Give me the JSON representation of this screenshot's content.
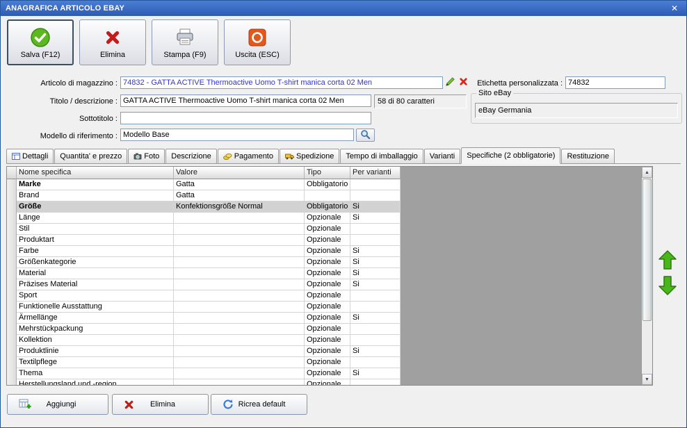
{
  "window": {
    "title": "ANAGRAFICA ARTICOLO EBAY",
    "close_glyph": "✕"
  },
  "toolbar": {
    "save": "Salva (F12)",
    "delete": "Elimina",
    "print": "Stampa (F9)",
    "exit": "Uscita (ESC)"
  },
  "form": {
    "articolo_label": "Articolo di magazzino :",
    "articolo_value": "74832 - GATTA ACTIVE Thermoactive Uomo T-shirt manica corta 02 Men",
    "etichetta_label": "Etichetta personalizzata :",
    "etichetta_value": "74832",
    "titolo_label": "Titolo / descrizione :",
    "titolo_value": "GATTA ACTIVE Thermoactive Uomo T-shirt manica corta 02 Men",
    "caratteri_info": "58 di 80 caratteri",
    "sito_group_label": "Sito eBay",
    "sito_value": "eBay Germania",
    "sottotitolo_label": "Sottotitolo :",
    "sottotitolo_value": "",
    "modello_label": "Modello di riferimento :",
    "modello_value": "Modello Base"
  },
  "tabs": [
    {
      "label": "Dettagli",
      "icon": "details-icon",
      "active": false
    },
    {
      "label": "Quantita' e prezzo",
      "icon": "",
      "active": false
    },
    {
      "label": "Foto",
      "icon": "camera-icon",
      "active": false
    },
    {
      "label": "Descrizione",
      "icon": "",
      "active": false
    },
    {
      "label": "Pagamento",
      "icon": "money-icon",
      "active": false
    },
    {
      "label": "Spedizione",
      "icon": "shipping-icon",
      "active": false
    },
    {
      "label": "Tempo di imballaggio",
      "icon": "",
      "active": false
    },
    {
      "label": "Varianti",
      "icon": "",
      "active": false
    },
    {
      "label": "Specifiche (2 obbligatorie)",
      "icon": "",
      "active": true
    },
    {
      "label": "Restituzione",
      "icon": "",
      "active": false
    }
  ],
  "grid": {
    "headers": [
      "Nome specifica",
      "Valore",
      "Tipo",
      "Per varianti"
    ],
    "rows": [
      {
        "nome": "Marke",
        "valore": "Gatta",
        "tipo": "Obbligatorio",
        "per_varianti": "",
        "bold": true,
        "selected": false
      },
      {
        "nome": "Brand",
        "valore": "Gatta",
        "tipo": "",
        "per_varianti": "",
        "bold": false,
        "selected": false
      },
      {
        "nome": "Größe",
        "valore": "Konfektionsgröße Normal",
        "tipo": "Obbligatorio",
        "per_varianti": "Si",
        "bold": true,
        "selected": true
      },
      {
        "nome": "Länge",
        "valore": "",
        "tipo": "Opzionale",
        "per_varianti": "Si",
        "bold": false,
        "selected": false
      },
      {
        "nome": "Stil",
        "valore": "",
        "tipo": "Opzionale",
        "per_varianti": "",
        "bold": false,
        "selected": false
      },
      {
        "nome": "Produktart",
        "valore": "",
        "tipo": "Opzionale",
        "per_varianti": "",
        "bold": false,
        "selected": false
      },
      {
        "nome": "Farbe",
        "valore": "",
        "tipo": "Opzionale",
        "per_varianti": "Si",
        "bold": false,
        "selected": false
      },
      {
        "nome": "Größenkategorie",
        "valore": "",
        "tipo": "Opzionale",
        "per_varianti": "Si",
        "bold": false,
        "selected": false
      },
      {
        "nome": "Material",
        "valore": "",
        "tipo": "Opzionale",
        "per_varianti": "Si",
        "bold": false,
        "selected": false
      },
      {
        "nome": "Präzises Material",
        "valore": "",
        "tipo": "Opzionale",
        "per_varianti": "Si",
        "bold": false,
        "selected": false
      },
      {
        "nome": "Sport",
        "valore": "",
        "tipo": "Opzionale",
        "per_varianti": "",
        "bold": false,
        "selected": false
      },
      {
        "nome": "Funktionelle Ausstattung",
        "valore": "",
        "tipo": "Opzionale",
        "per_varianti": "",
        "bold": false,
        "selected": false
      },
      {
        "nome": "Ärmellänge",
        "valore": "",
        "tipo": "Opzionale",
        "per_varianti": "Si",
        "bold": false,
        "selected": false
      },
      {
        "nome": "Mehrstückpackung",
        "valore": "",
        "tipo": "Opzionale",
        "per_varianti": "",
        "bold": false,
        "selected": false
      },
      {
        "nome": "Kollektion",
        "valore": "",
        "tipo": "Opzionale",
        "per_varianti": "",
        "bold": false,
        "selected": false
      },
      {
        "nome": "Produktlinie",
        "valore": "",
        "tipo": "Opzionale",
        "per_varianti": "Si",
        "bold": false,
        "selected": false
      },
      {
        "nome": "Textilpflege",
        "valore": "",
        "tipo": "Opzionale",
        "per_varianti": "",
        "bold": false,
        "selected": false
      },
      {
        "nome": "Thema",
        "valore": "",
        "tipo": "Opzionale",
        "per_varianti": "Si",
        "bold": false,
        "selected": false
      },
      {
        "nome": "Herstellungsland und -region",
        "valore": "",
        "tipo": "Opzionale",
        "per_varianti": "",
        "bold": false,
        "selected": false
      }
    ]
  },
  "bottom": {
    "add": "Aggiungi",
    "delete": "Elimina",
    "recreate": "Ricrea default"
  },
  "colors": {
    "titlebar_blue": "#2f5fb8",
    "field_text_blue": "#3333cc",
    "grid_filler_gray": "#a0a0a0",
    "selected_row_gray": "#d2d2d2",
    "icon_green": "#49b61c",
    "icon_red": "#c21d1d",
    "icon_orange": "#e4581c"
  }
}
